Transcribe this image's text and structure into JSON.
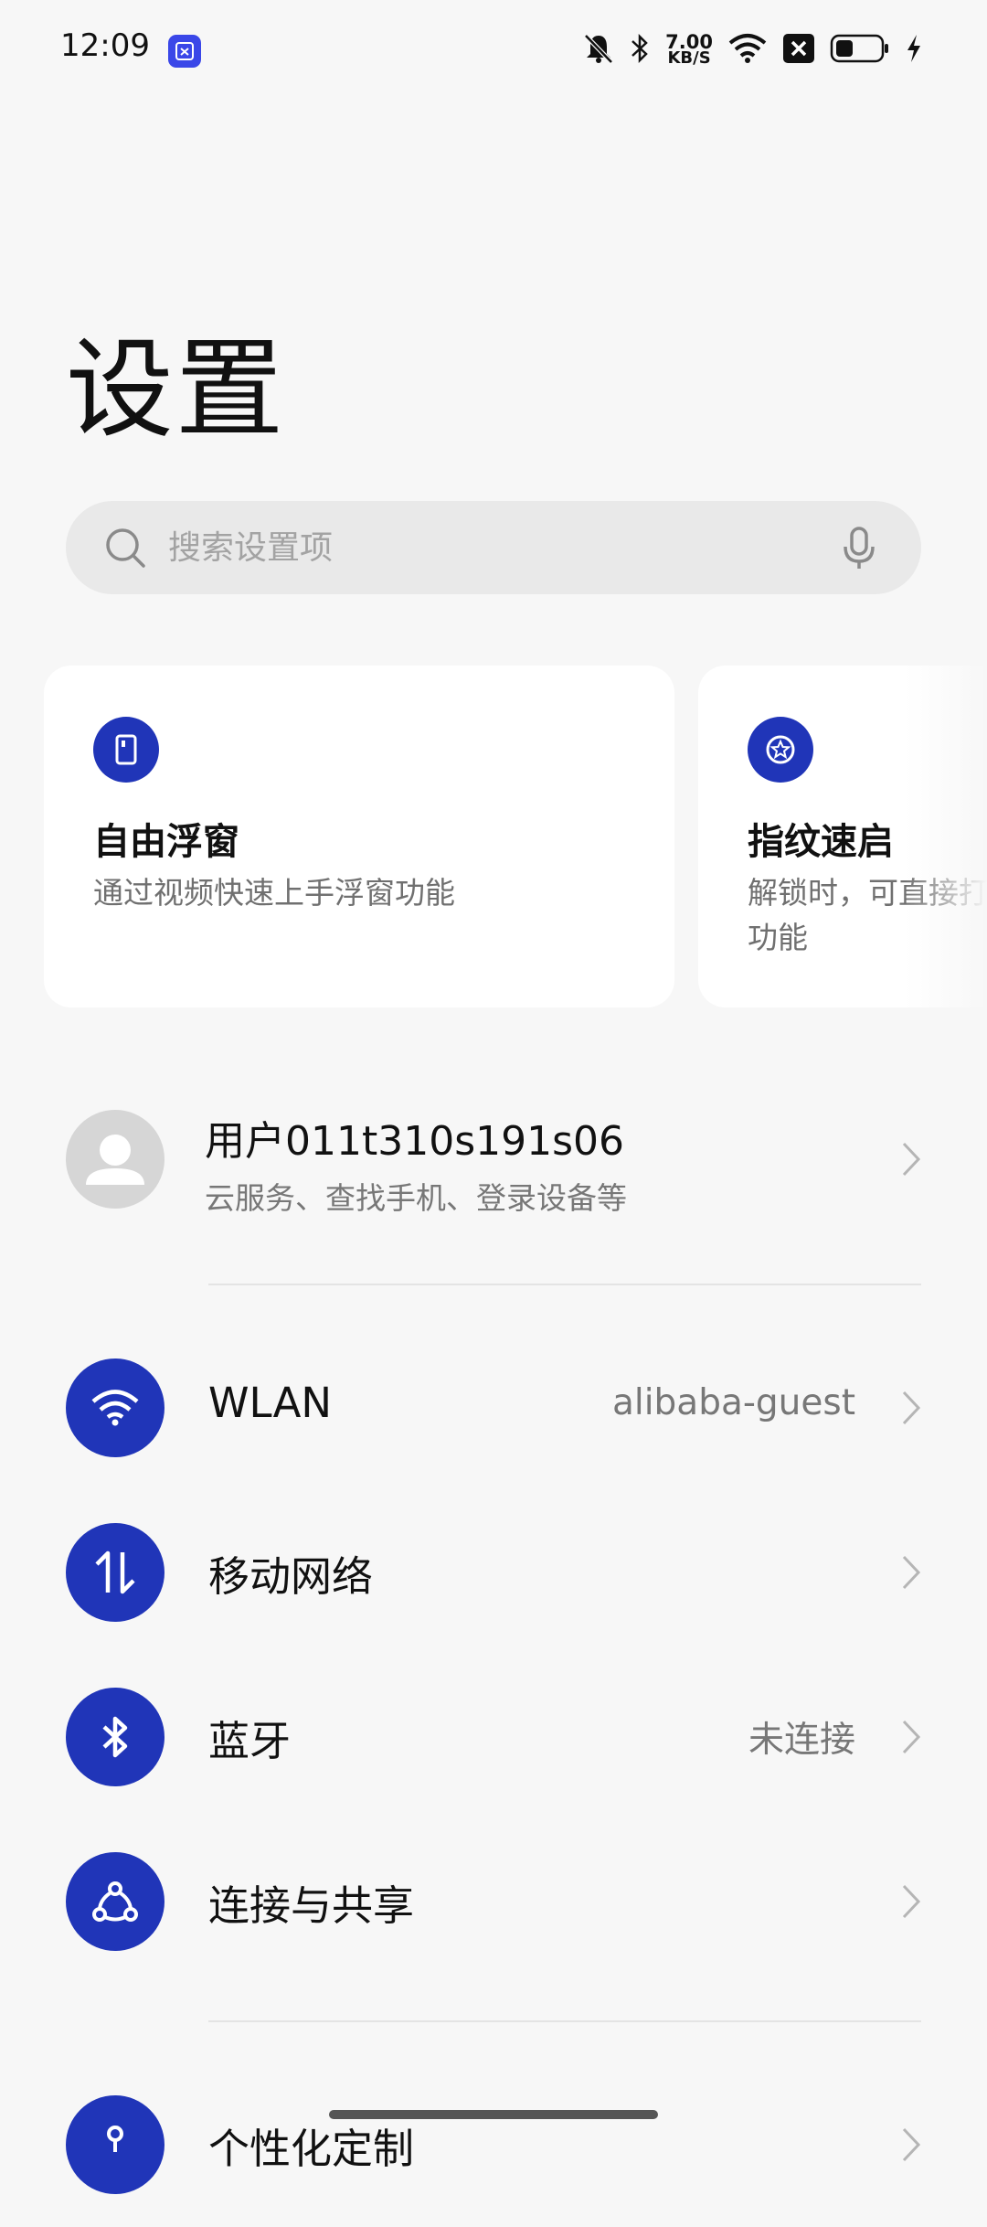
{
  "status_bar": {
    "time": "12:09",
    "net_speed_value": "7.00",
    "net_speed_unit": "KB/S",
    "icons": [
      "app-screen-icon",
      "mute-bell-icon",
      "bluetooth-icon",
      "wifi-icon",
      "sim-none-icon",
      "battery-icon",
      "charging-icon"
    ]
  },
  "page": {
    "title": "设置"
  },
  "search": {
    "placeholder": "搜索设置项"
  },
  "cards": [
    {
      "title": "自由浮窗",
      "desc": "通过视频快速上手浮窗功能",
      "icon": "floating-window-icon"
    },
    {
      "title": "指纹速启",
      "desc": "解锁时，可直接打开 功能",
      "icon": "fingerprint-star-icon"
    }
  ],
  "account": {
    "name": "用户011t310s191s06",
    "subtitle": "云服务、查找手机、登录设备等"
  },
  "settings": [
    {
      "label": "WLAN",
      "value": "alibaba-guest",
      "icon": "wifi-icon"
    },
    {
      "label": "移动网络",
      "value": "",
      "icon": "mobile-data-icon"
    },
    {
      "label": "蓝牙",
      "value": "未连接",
      "icon": "bluetooth-icon"
    },
    {
      "label": "连接与共享",
      "value": "",
      "icon": "share-connection-icon"
    },
    {
      "label": "个性化定制",
      "value": "",
      "icon": "personalization-icon"
    }
  ],
  "colors": {
    "accent": "#2035b8",
    "badge": "#3a47e8",
    "background": "#f7f7f7"
  }
}
